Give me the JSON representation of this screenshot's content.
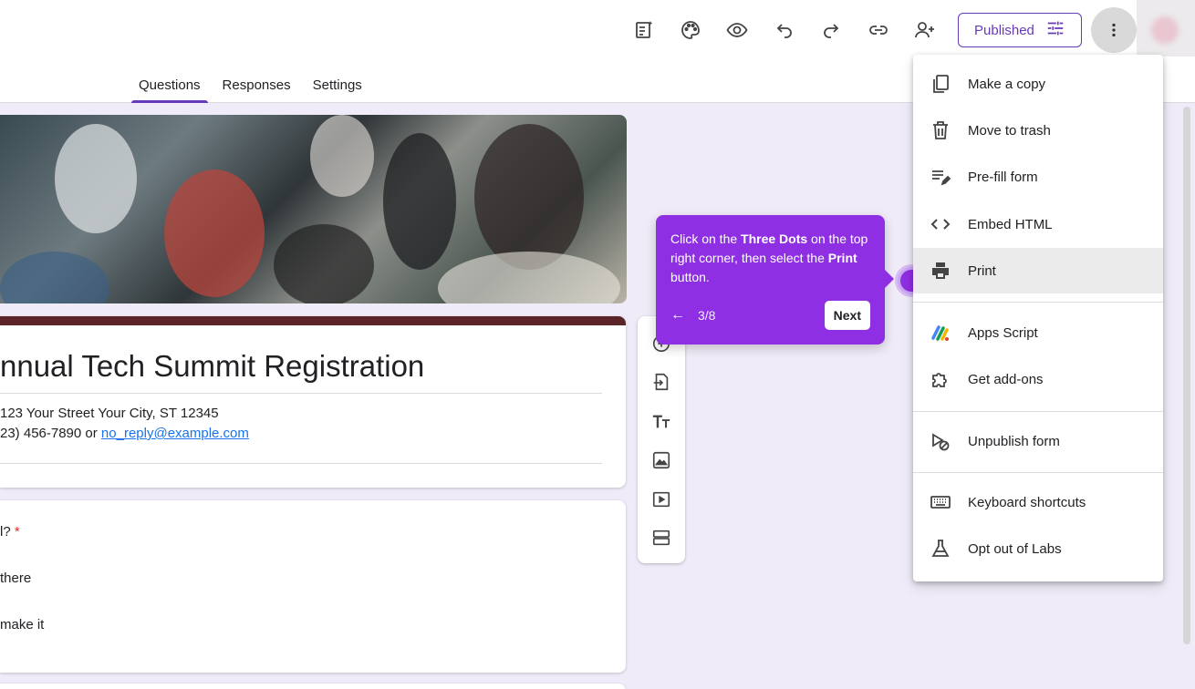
{
  "toolbar": {
    "published_label": "Published"
  },
  "tabs": [
    {
      "label": "Questions"
    },
    {
      "label": "Responses"
    },
    {
      "label": "Settings"
    }
  ],
  "form": {
    "title": "nnual Tech Summit Registration",
    "desc_line1": "123 Your Street Your City, ST 12345",
    "desc_line2_prefix": "23) 456-7890 or ",
    "desc_email": "no_reply@example.com"
  },
  "question": {
    "text": "l?",
    "required_mark": "*",
    "option1": "there",
    "option2": "make it"
  },
  "tooltip": {
    "msg_part1": "Click on the ",
    "msg_bold1": "Three Dots",
    "msg_part2": " on the top right corner, then select the ",
    "msg_bold2": "Print",
    "msg_part3": " button.",
    "back": "←",
    "step": "3/8",
    "next": "Next"
  },
  "menu": {
    "items": [
      {
        "label": "Make a copy",
        "icon": "copy-icon"
      },
      {
        "label": "Move to trash",
        "icon": "trash-icon"
      },
      {
        "label": "Pre-fill form",
        "icon": "prefill-icon"
      },
      {
        "label": "Embed HTML",
        "icon": "code-icon"
      },
      {
        "label": "Print",
        "icon": "print-icon"
      },
      {
        "label": "Apps Script",
        "icon": "apps-script-icon"
      },
      {
        "label": "Get add-ons",
        "icon": "puzzle-icon"
      },
      {
        "label": "Unpublish form",
        "icon": "unpublish-icon"
      },
      {
        "label": "Keyboard shortcuts",
        "icon": "keyboard-icon"
      },
      {
        "label": "Opt out of Labs",
        "icon": "flask-icon"
      }
    ]
  },
  "colors": {
    "accent": "#673ab7",
    "tooltip": "#8e2fe3",
    "header_bar": "#5b2429",
    "link": "#1a73e8",
    "required": "#d93025"
  }
}
